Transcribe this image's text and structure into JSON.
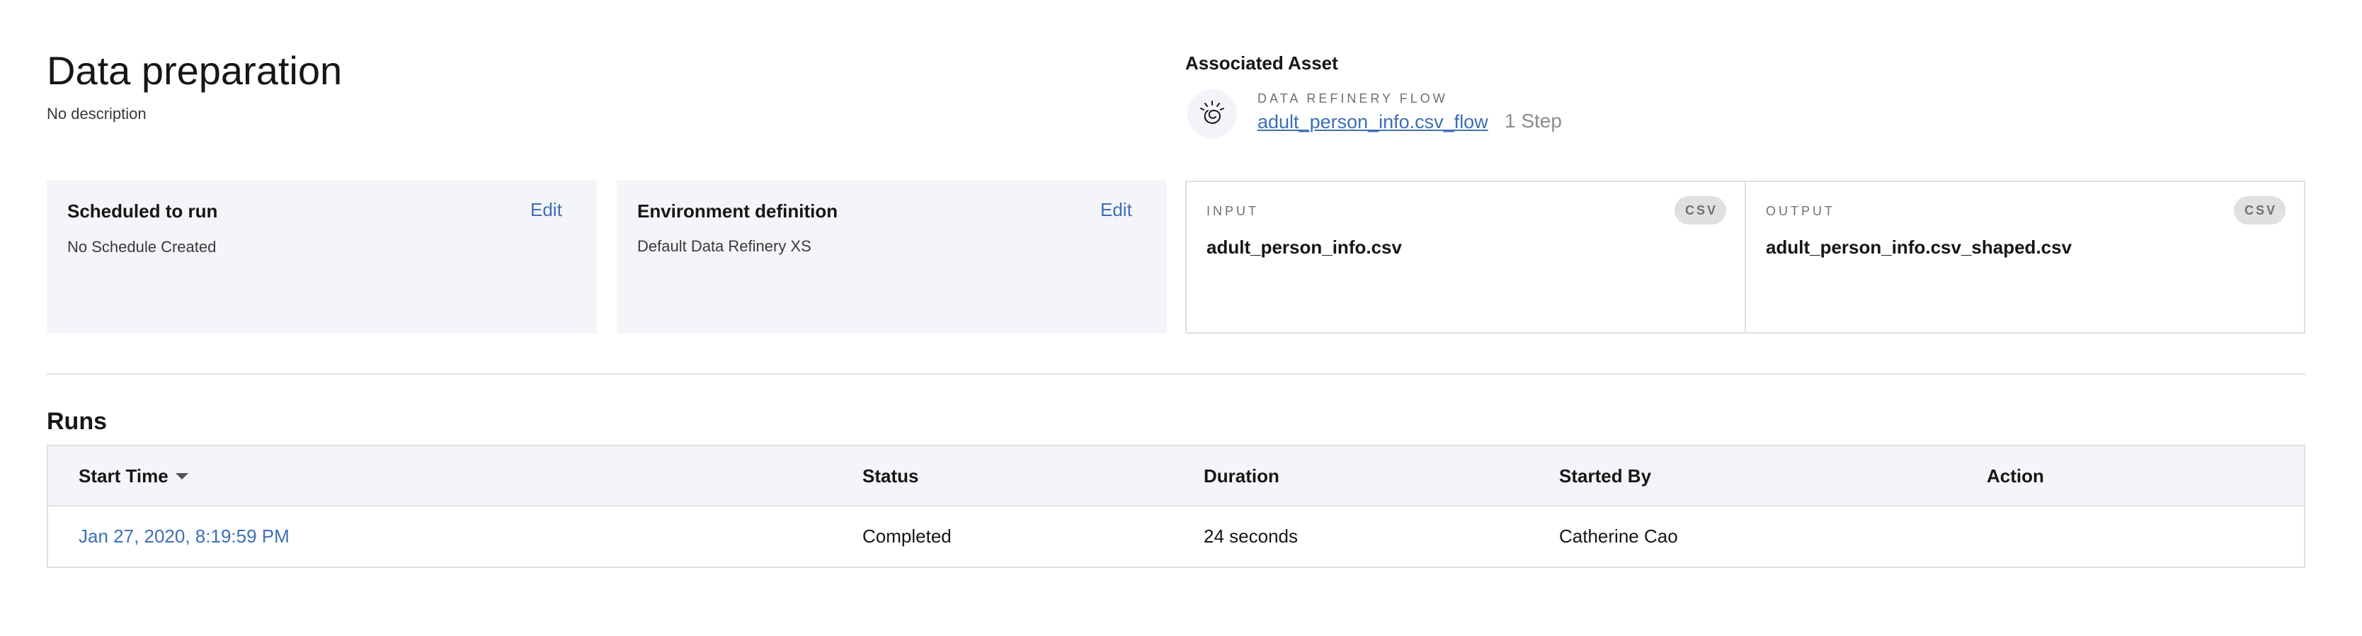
{
  "header": {
    "title": "Data preparation",
    "description": "No description"
  },
  "associated_asset": {
    "heading": "Associated Asset",
    "icon": "data-refinery-icon",
    "type_label": "DATA REFINERY FLOW",
    "name": "adult_person_info.csv_flow",
    "steps": "1 Step"
  },
  "schedule": {
    "title": "Scheduled to run",
    "value": "No Schedule Created",
    "edit_label": "Edit"
  },
  "environment": {
    "title": "Environment definition",
    "value": "Default Data Refinery XS",
    "edit_label": "Edit"
  },
  "input": {
    "label": "INPUT",
    "badge": "CSV",
    "file": "adult_person_info.csv"
  },
  "output": {
    "label": "OUTPUT",
    "badge": "CSV",
    "file": "adult_person_info.csv_shaped.csv"
  },
  "runs": {
    "heading": "Runs",
    "columns": [
      "Start Time",
      "Status",
      "Duration",
      "Started By",
      "Action"
    ],
    "sort_icon": "caret-down-icon",
    "rows": [
      {
        "start_time": "Jan 27, 2020, 8:19:59 PM",
        "status": "Completed",
        "duration": "24 seconds",
        "started_by": "Catherine Cao",
        "action": ""
      }
    ]
  },
  "colors": {
    "link": "#3d6fb6",
    "tile_bg": "#f4f5f8",
    "border": "#e0e0e0",
    "text": "#161616"
  }
}
